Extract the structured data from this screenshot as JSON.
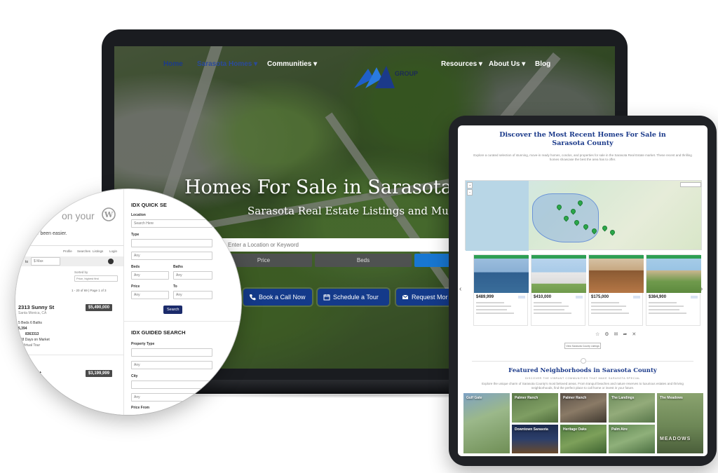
{
  "laptop": {
    "nav": {
      "home": "Home",
      "area": "Sarasota Homes ▾",
      "communities": "Communities ▾",
      "brand_fragment": "GROUP",
      "resources": "Resources ▾",
      "about": "About Us ▾",
      "blog": "Blog"
    },
    "hero_title": "Homes For Sale in Sarasota",
    "hero_subtitle": "Sarasota Real Estate Listings and Much M",
    "search_placeholder": "Enter a Location or Keyword",
    "filters": [
      "Price",
      "Beds"
    ],
    "cta": {
      "call": "Book a Call Now",
      "tour": "Schedule a Tour",
      "request": "Request Mor"
    }
  },
  "zoom": {
    "wp_text": "on your",
    "easier": "never been easier.",
    "tabs": [
      "Profile",
      "Searches",
      "Listings",
      "Login"
    ],
    "max": "$ Max",
    "to": "to",
    "sorted_by": "Sorted by",
    "sort_value": "Price, highest first",
    "results": "1 - 20 of 69 |  Page 1 of 3",
    "listing1": {
      "address": "2313 Sunny St",
      "city": "Santa Monica, CA",
      "price": "$5,490,000",
      "specs": "5 Beds   6 Baths",
      "sqft": "5,394",
      "mls": "8363313",
      "dom": "448 Days on Market",
      "tour": "Virtual Tour"
    },
    "listing2": {
      "address": "nny St",
      "city": "CA",
      "price": "$3,199,999"
    },
    "quick_title": "IDX QUICK SE",
    "quick": {
      "location": "Location",
      "location_ph": "Search Here",
      "type": "Type",
      "any": "Any",
      "beds": "Beds",
      "baths": "Baths",
      "price": "Price",
      "to": "To",
      "search": "Search"
    },
    "guided_title": "IDX GUIDED SEARCH",
    "guided": {
      "property_type": "Property Type",
      "any": "Any",
      "city": "City",
      "price_from": "Price From"
    }
  },
  "tablet": {
    "title_line1": "Discover the Most Recent Homes For Sale in",
    "title_line2": "Sarasota County",
    "intro": "Explore a curated selection of stunning, move-in ready homes, condos, and properties for sale in the Sarasota Real Estate market. These recent and thrilling homes showcase the best the area has to offer.",
    "cards": [
      {
        "price": "$489,999"
      },
      {
        "price": "$410,000"
      },
      {
        "price": "$175,000"
      },
      {
        "price": "$384,900"
      }
    ],
    "view_all": "View Sarasota County Listings",
    "nb_title": "Featured Neighborhoods in Sarasota County",
    "nb_sub": "DISCOVER THE VIBRANT COMMUNITIES THAT MAKE SARASOTA SPECIAL",
    "nb_intro": "Explore the unique charm of Sarasota County's most beloved areas. From tranquil beaches and nature reserves to luxurious estates and thriving neighborhoods, find the perfect place to call home or invest in your future.",
    "neighborhoods": [
      "Gulf Gate",
      "Palmer Ranch",
      "Palmer Ranch",
      "The Landings",
      "The Meadows",
      "Downtown Sarasota",
      "Heritage Oaks",
      "Palm Aire"
    ],
    "meadows_sign": "MEADOWS"
  }
}
